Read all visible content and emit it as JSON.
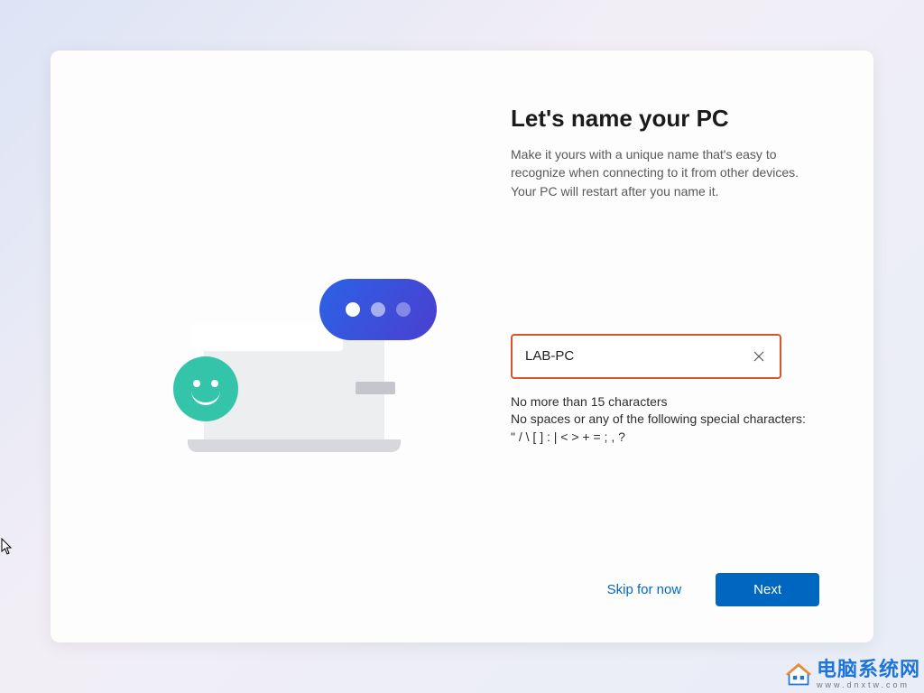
{
  "header": {
    "title": "Let's name your PC",
    "description": "Make it yours with a unique name that's easy to recognize when connecting to it from other devices. Your PC will restart after you name it."
  },
  "input": {
    "value": "LAB-PC",
    "placeholder": ""
  },
  "hints": {
    "line1": "No more than 15 characters",
    "line2": "No spaces or any of the following special characters:",
    "line3": "\" / \\ [ ] : | < > + = ; , ?"
  },
  "actions": {
    "skip_label": "Skip for now",
    "next_label": "Next"
  },
  "watermark": {
    "brand": "电脑系统网",
    "url": "www.dnxtw.com"
  },
  "colors": {
    "accent_blue": "#0067c0",
    "highlight_border": "#d9542a",
    "smiley_green": "#34c4a9",
    "bubble_start": "#2b62e6",
    "bubble_end": "#4b3fcf"
  }
}
